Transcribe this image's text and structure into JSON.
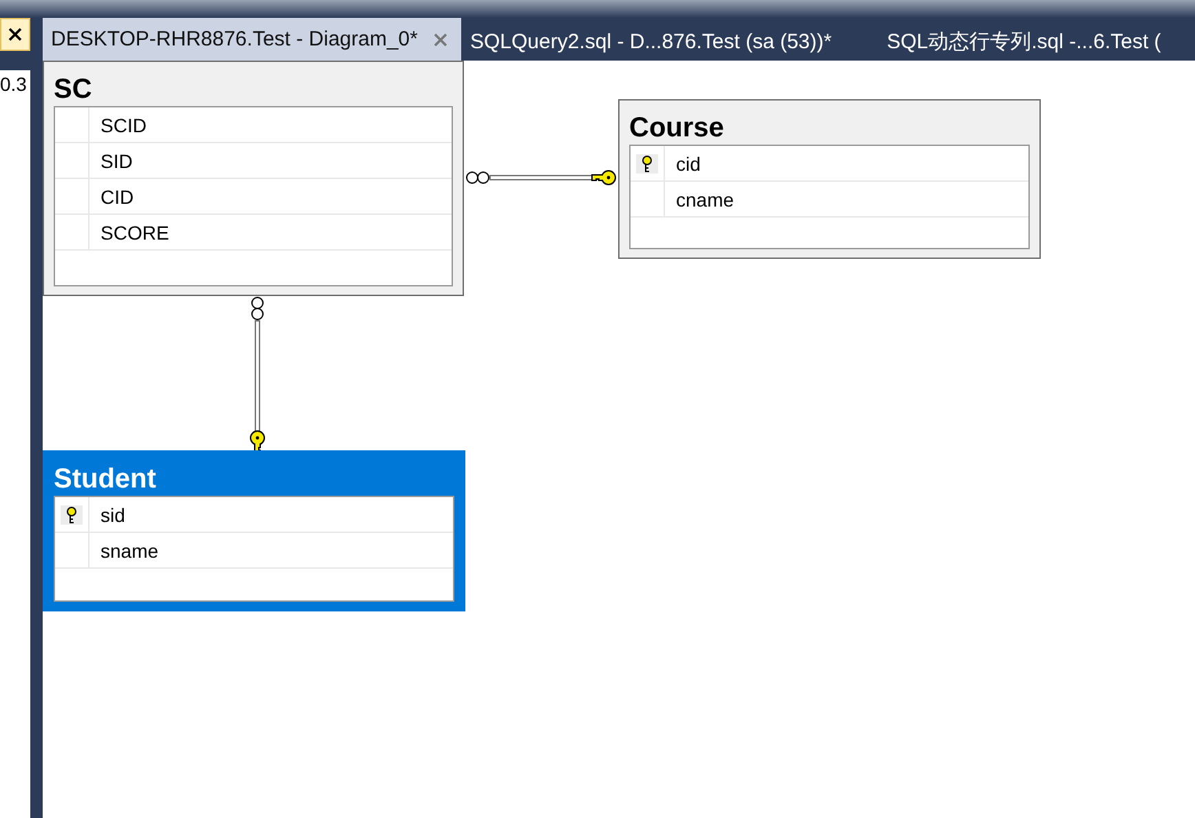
{
  "left_panel": {
    "close_button": true,
    "text": "0.3"
  },
  "tabs": [
    {
      "label": "DESKTOP-RHR8876.Test - Diagram_0*",
      "selected": true,
      "closable": true
    },
    {
      "label": "SQLQuery2.sql - D...876.Test (sa (53))*",
      "selected": false,
      "closable": false
    },
    {
      "label": "SQL动态行专列.sql -...6.Test (",
      "selected": false,
      "closable": false
    }
  ],
  "tables": [
    {
      "name": "SC",
      "selected": false,
      "columns": [
        {
          "name": "SCID",
          "primary_key": false
        },
        {
          "name": "SID",
          "primary_key": false
        },
        {
          "name": "CID",
          "primary_key": false
        },
        {
          "name": "SCORE",
          "primary_key": false
        }
      ]
    },
    {
      "name": "Course",
      "selected": false,
      "columns": [
        {
          "name": "cid",
          "primary_key": true
        },
        {
          "name": "cname",
          "primary_key": false
        }
      ]
    },
    {
      "name": "Student",
      "selected": true,
      "columns": [
        {
          "name": "sid",
          "primary_key": true
        },
        {
          "name": "sname",
          "primary_key": false
        }
      ]
    }
  ]
}
